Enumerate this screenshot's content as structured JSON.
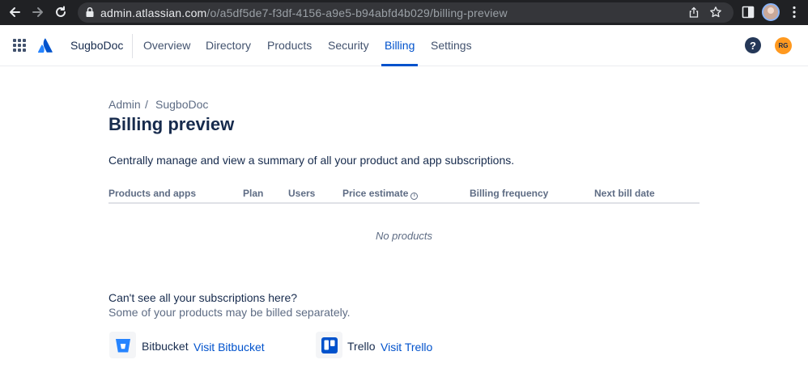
{
  "browser": {
    "url_host": "admin.atlassian.com",
    "url_path": "/o/a5df5de7-f3df-4156-a9e5-b94abfd4b029/billing-preview"
  },
  "topnav": {
    "org_name": "SugboDoc",
    "tabs": [
      {
        "label": "Overview",
        "active": false
      },
      {
        "label": "Directory",
        "active": false
      },
      {
        "label": "Products",
        "active": false
      },
      {
        "label": "Security",
        "active": false
      },
      {
        "label": "Billing",
        "active": true
      },
      {
        "label": "Settings",
        "active": false
      }
    ],
    "help_glyph": "?",
    "avatar_initials": "RG"
  },
  "breadcrumb": {
    "items": [
      "Admin",
      "SugboDoc"
    ],
    "separator": "/"
  },
  "page": {
    "title": "Billing preview",
    "description": "Centrally manage and view a summary of all your product and app subscriptions."
  },
  "table": {
    "headers": [
      "Products and apps",
      "Plan",
      "Users",
      "Price estimate",
      "Billing frequency",
      "Next bill date"
    ],
    "empty_text": "No products"
  },
  "separate_billing": {
    "heading": "Can't see all your subscriptions here?",
    "subtext": "Some of your products may be billed separately.",
    "products": [
      {
        "name": "Bitbucket",
        "link": "Visit Bitbucket",
        "icon": "bitbucket-icon",
        "color": "#2684ff"
      },
      {
        "name": "Trello",
        "link": "Visit Trello",
        "icon": "trello-icon",
        "color": "#0052cc"
      }
    ]
  },
  "colors": {
    "accent": "#0052cc",
    "avatar_bg": "#ff991f"
  }
}
